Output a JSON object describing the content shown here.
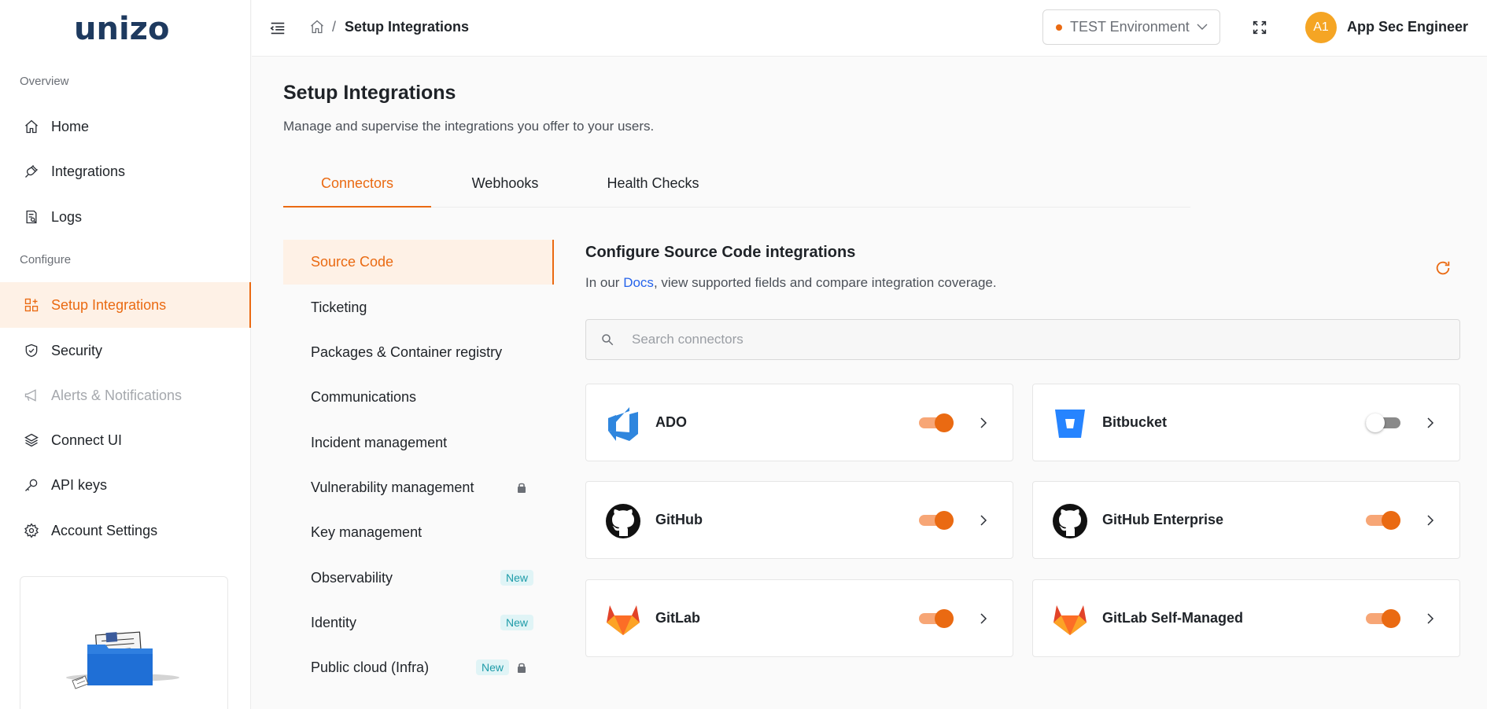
{
  "brand": {
    "logo_text": "unizo"
  },
  "sidebar": {
    "sections": [
      {
        "label": "Overview"
      },
      {
        "label": "Configure"
      }
    ],
    "items": [
      {
        "label": "Home",
        "icon": "home-icon"
      },
      {
        "label": "Integrations",
        "icon": "plug-icon"
      },
      {
        "label": "Logs",
        "icon": "log-icon"
      },
      {
        "label": "Setup Integrations",
        "icon": "apps-icon",
        "active": true
      },
      {
        "label": "Security",
        "icon": "shield-icon"
      },
      {
        "label": "Alerts & Notifications",
        "icon": "megaphone-icon",
        "disabled": true
      },
      {
        "label": "Connect UI",
        "icon": "layers-icon"
      },
      {
        "label": "API keys",
        "icon": "key-icon"
      },
      {
        "label": "Account Settings",
        "icon": "gear-icon"
      }
    ]
  },
  "header": {
    "breadcrumb_current": "Setup Integrations",
    "breadcrumb_sep": "/",
    "environment": "TEST Environment",
    "avatar_initials": "A1",
    "user_name": "App Sec Engineer"
  },
  "page": {
    "title": "Setup Integrations",
    "subtitle": "Manage and supervise the integrations you offer to your users."
  },
  "tabs": [
    {
      "label": "Connectors",
      "active": true
    },
    {
      "label": "Webhooks"
    },
    {
      "label": "Health Checks"
    }
  ],
  "categories": [
    {
      "label": "Source Code",
      "active": true
    },
    {
      "label": "Ticketing"
    },
    {
      "label": "Packages & Container registry"
    },
    {
      "label": "Communications"
    },
    {
      "label": "Incident management"
    },
    {
      "label": "Vulnerability management",
      "locked": true
    },
    {
      "label": "Key management"
    },
    {
      "label": "Observability",
      "badge": "New"
    },
    {
      "label": "Identity",
      "badge": "New"
    },
    {
      "label": "Public cloud (Infra)",
      "badge": "New",
      "locked": true
    }
  ],
  "content": {
    "title": "Configure Source Code integrations",
    "desc_prefix": "In our ",
    "desc_link": "Docs",
    "desc_suffix": ", view supported fields and compare integration coverage.",
    "search_placeholder": "Search connectors"
  },
  "connectors": [
    {
      "name": "ADO",
      "enabled": true
    },
    {
      "name": "Bitbucket",
      "enabled": false
    },
    {
      "name": "GitHub",
      "enabled": true
    },
    {
      "name": "GitHub Enterprise",
      "enabled": true
    },
    {
      "name": "GitLab",
      "enabled": true
    },
    {
      "name": "GitLab Self-Managed",
      "enabled": true
    }
  ],
  "colors": {
    "accent": "#ea6a12",
    "accent_light": "#fef1e6",
    "brand_navy": "#1e3a5f",
    "link": "#2563eb",
    "badge_bg": "#e0f4f6",
    "badge_text": "#1d9ba8"
  }
}
